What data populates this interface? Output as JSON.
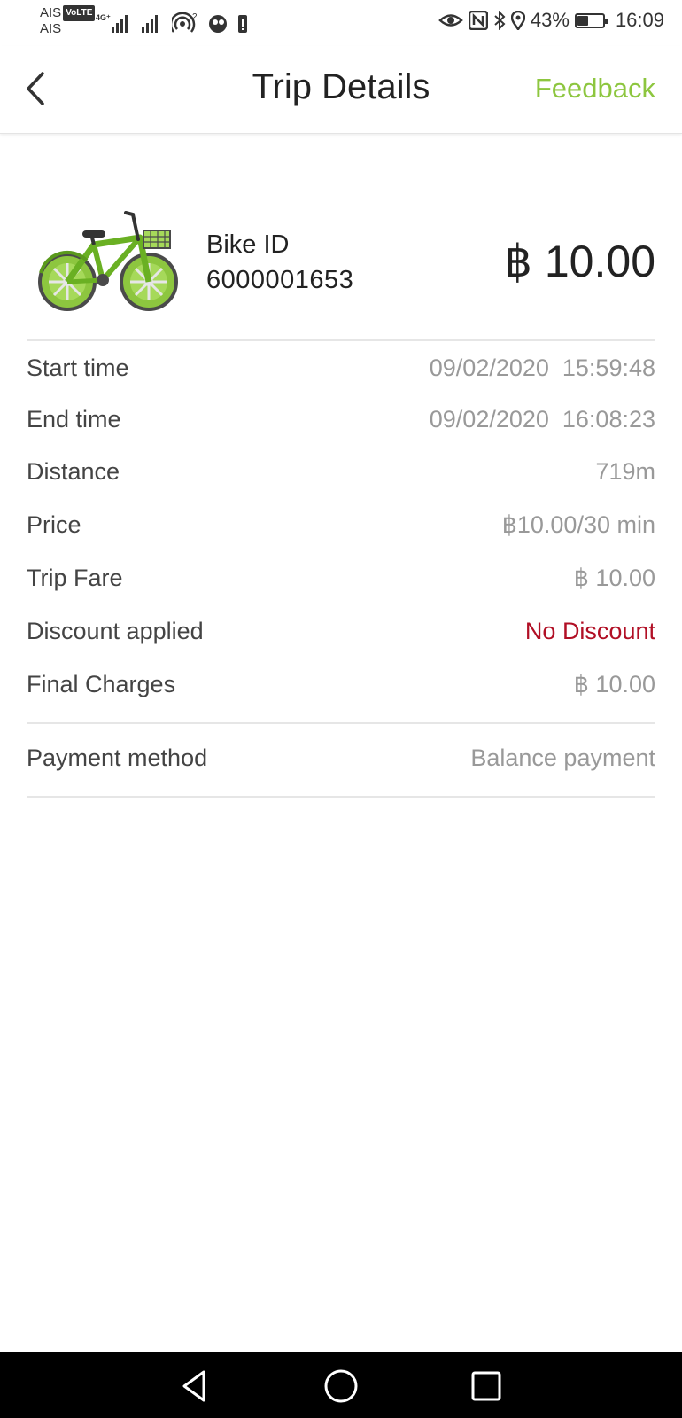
{
  "status_bar": {
    "carrier_top": "AIS",
    "carrier_bottom": "AIS",
    "volte": "VoLTE",
    "network": "4G+",
    "hotspot_count": "2",
    "battery_percent": "43%",
    "battery_level": 0.43,
    "time": "16:09"
  },
  "header": {
    "title": "Trip Details",
    "feedback": "Feedback"
  },
  "summary": {
    "bike_id_label": "Bike ID",
    "bike_id": "6000001653",
    "total": "฿ 10.00"
  },
  "details": [
    {
      "label": "Start time",
      "value": "09/02/2020  15:59:48"
    },
    {
      "label": "End time",
      "value": "09/02/2020  16:08:23"
    },
    {
      "label": "Distance",
      "value": "719m"
    },
    {
      "label": "Price",
      "value": "฿10.00/30 min"
    },
    {
      "label": "Trip Fare",
      "value": "฿ 10.00"
    },
    {
      "label": "Discount applied",
      "value": "No Discount"
    },
    {
      "label": "Final Charges",
      "value": "฿ 10.00"
    }
  ],
  "payment": {
    "label": "Payment method",
    "value": "Balance payment"
  },
  "colors": {
    "accent": "#8dc63f",
    "discount": "#b10f25",
    "value_text": "#999999"
  },
  "icons": {
    "back": "chevron-left-icon",
    "bike": "bicycle-icon",
    "nav_back": "triangle-back-icon",
    "nav_home": "circle-home-icon",
    "nav_recents": "square-recents-icon"
  }
}
